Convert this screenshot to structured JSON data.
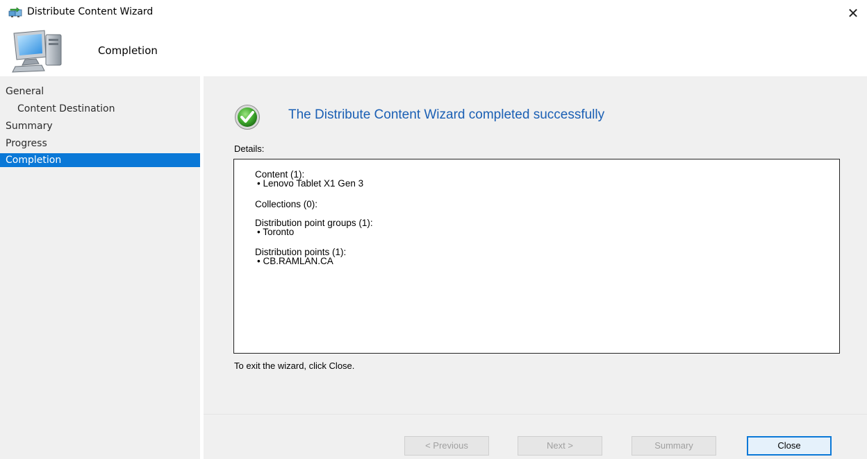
{
  "window": {
    "title": "Distribute Content Wizard",
    "close_glyph": "✕",
    "title_icon": "distribute-content-icon"
  },
  "header": {
    "icon": "computer-icon",
    "title": "Completion"
  },
  "sidebar": {
    "items": [
      {
        "label": "General",
        "selected": false,
        "indent": 0
      },
      {
        "label": "Content Destination",
        "selected": false,
        "indent": 1
      },
      {
        "label": "Summary",
        "selected": false,
        "indent": 0
      },
      {
        "label": "Progress",
        "selected": false,
        "indent": 0
      },
      {
        "label": "Completion",
        "selected": true,
        "indent": 0
      }
    ]
  },
  "main": {
    "status_icon": "success-check-icon",
    "heading": "The Distribute Content Wizard completed successfully",
    "details_label": "Details:",
    "details": [
      {
        "header": "Content (1):",
        "items": [
          "• Lenovo Tablet X1 Gen 3"
        ]
      },
      {
        "header": "Collections (0):",
        "items": []
      },
      {
        "header": "Distribution point groups (1):",
        "items": [
          "• Toronto"
        ]
      },
      {
        "header": "Distribution points (1):",
        "items": [
          "• CB.RAMLAN.CA"
        ]
      }
    ],
    "exit_text": "To exit the wizard, click Close."
  },
  "footer": {
    "previous": "< Previous",
    "next": "Next >",
    "summary": "Summary",
    "close": "Close"
  },
  "colors": {
    "selection": "#0a78d7",
    "heading": "#1a5fb4",
    "panel": "#f0f0f0"
  }
}
